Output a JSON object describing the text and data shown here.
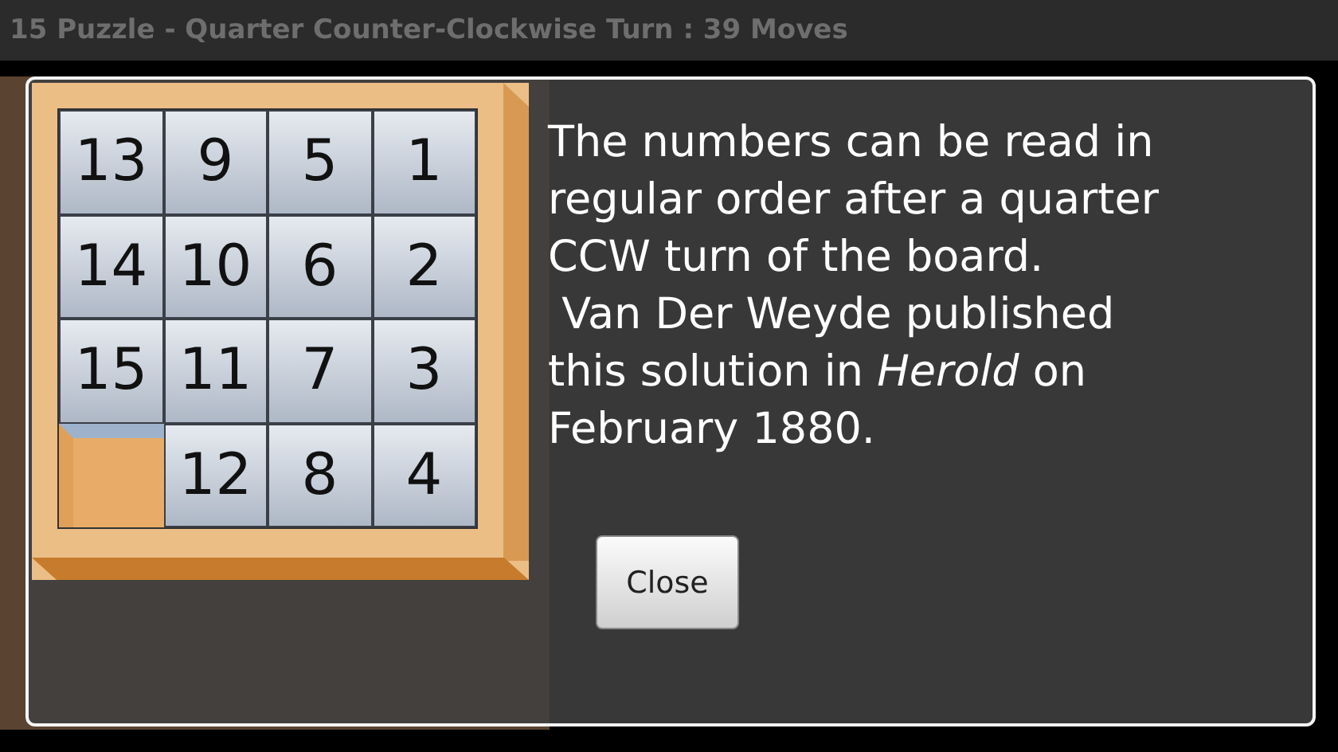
{
  "window": {
    "title": "15 Puzzle - Quarter Counter-Clockwise Turn : 39 Moves"
  },
  "dialog": {
    "tiles": [
      {
        "kind": "tile",
        "label": "13"
      },
      {
        "kind": "tile",
        "label": "9"
      },
      {
        "kind": "tile",
        "label": "5"
      },
      {
        "kind": "tile",
        "label": "1"
      },
      {
        "kind": "tile",
        "label": "14"
      },
      {
        "kind": "tile",
        "label": "10"
      },
      {
        "kind": "tile",
        "label": "6"
      },
      {
        "kind": "tile",
        "label": "2"
      },
      {
        "kind": "tile",
        "label": "15"
      },
      {
        "kind": "tile",
        "label": "11"
      },
      {
        "kind": "tile",
        "label": "7"
      },
      {
        "kind": "tile",
        "label": "3"
      },
      {
        "kind": "empty"
      },
      {
        "kind": "tile",
        "label": "12"
      },
      {
        "kind": "tile",
        "label": "8"
      },
      {
        "kind": "tile",
        "label": "4"
      }
    ],
    "message": "The numbers can be read in regular order after a quarter CCW turn of the board.\n Van Der Weyde published this solution in *Herold* on February 1880.",
    "button": "Close"
  }
}
